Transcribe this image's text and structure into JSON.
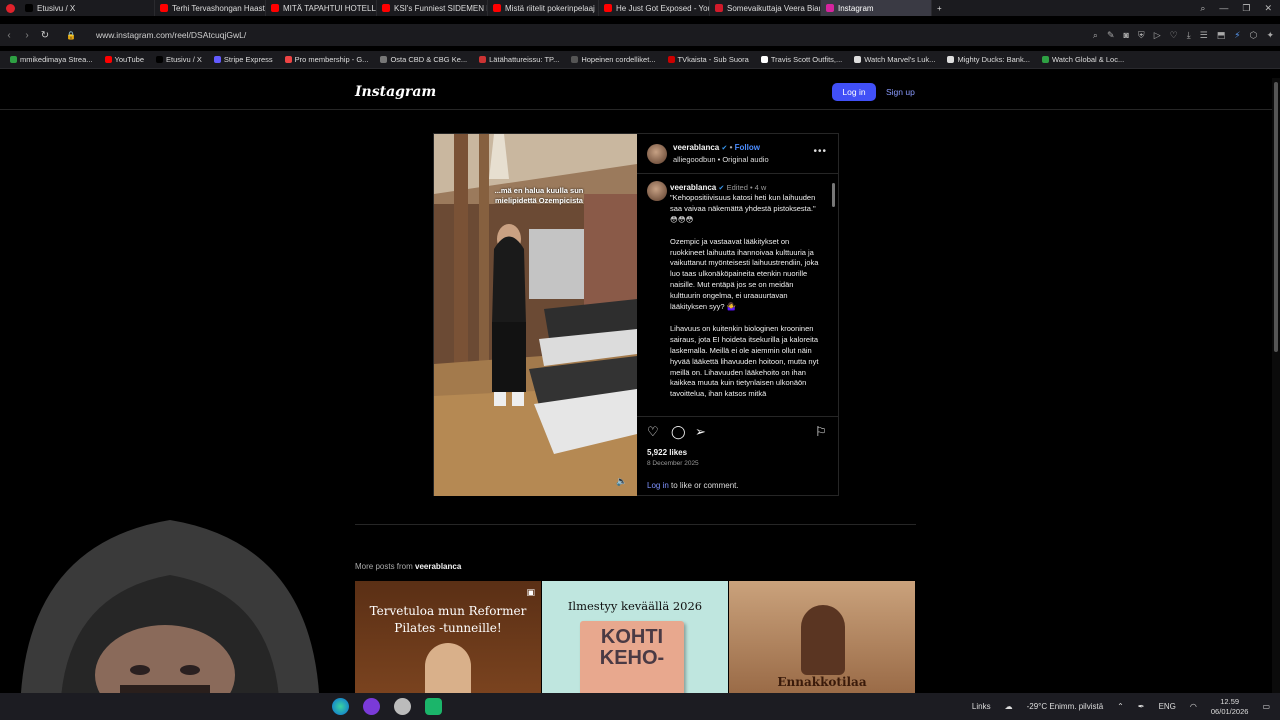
{
  "browser": {
    "tabs": [
      {
        "label": "Etusivu / X",
        "fav": "#000000"
      },
      {
        "label": "Terhi Tervashongan Haasta",
        "fav": "#ff0000"
      },
      {
        "label": "MITÄ TAPAHTUI HOTELLIS",
        "fav": "#ff0000"
      },
      {
        "label": "KSI's Funniest SIDEMEN M",
        "fav": "#ff0000"
      },
      {
        "label": "Mistä riitelit pokerinpelaaj",
        "fav": "#ff0000"
      },
      {
        "label": "He Just Got Exposed - You",
        "fav": "#ff0000"
      },
      {
        "label": "Somevaikuttaja Veera Bian",
        "fav": "#d11a2a"
      },
      {
        "label": "Instagram",
        "fav": "#d6249f"
      }
    ],
    "new_tab": "+",
    "url": "www.instagram.com/reel/DSAtcuqjGwL/",
    "bookmarks": [
      {
        "label": "mmikedimaya Strea...",
        "color": "#2ea043"
      },
      {
        "label": "YouTube",
        "color": "#ff0000"
      },
      {
        "label": "Etusivu / X",
        "color": "#000000"
      },
      {
        "label": "Stripe Express",
        "color": "#635bff"
      },
      {
        "label": "Pro membership - G...",
        "color": "#e44"
      },
      {
        "label": "Osta CBD & CBG Ke...",
        "color": "#777"
      },
      {
        "label": "Lätähattureissu: TP...",
        "color": "#c33"
      },
      {
        "label": "Hopeinen cordelliket...",
        "color": "#555"
      },
      {
        "label": "TVkaista - Sub Suora",
        "color": "#c00"
      },
      {
        "label": "Travis Scott Outfits,...",
        "color": "#fff"
      },
      {
        "label": "Watch Marvel's Luk...",
        "color": "#ddd"
      },
      {
        "label": "Mighty Ducks: Bank...",
        "color": "#ddd"
      },
      {
        "label": "Watch Global & Loc...",
        "color": "#2ea043"
      }
    ]
  },
  "instagram": {
    "logo": "Instagram",
    "login_label": "Log in",
    "signup_label": "Sign up",
    "post": {
      "video_caption": "...mä en halua kuulla sun mielipidettä Ozempicista",
      "owner": "veerablanca",
      "follow_label": "Follow",
      "audio": "alliegoodbun • Original audio",
      "comment_owner": "veerablanca",
      "comment_meta": "Edited • 4 w",
      "comment_text": "\"Kehopositiivisuus katosi heti kun laihuuden saa vaivaa näkemättä yhdestä pistoksesta.\" 😳😳😳\n\nOzempic ja vastaavat lääkitykset on ruokkineet laihuutta ihannoivaa kulttuuria ja vaikuttanut myönteisesti laihuustrendiin, joka luo taas ulkonäköpaineita etenkin nuorille naisille. Mut entäpä jos se on meidän kulttuurin ongelma, ei uraauurtavan lääkityksen syy? 🤷‍♀️\n\nLihavuus on kuitenkin biologinen krooninen sairaus, jota EI hoideta itsekurilla ja kaloreita laskemalla. Meillä ei ole aiemmin ollut näin hyvää lääkettä lihavuuden hoitoon, mutta nyt meillä on. Lihavuuden lääkehoito on ihan kaikkea muuta kuin tietynlaisen ulkonäön tavoittelua, ihan katsos mitkä",
      "likes": "5,922 likes",
      "date": "8 December 2025",
      "login_link": "Log in",
      "comment_prompt": " to like or comment."
    },
    "more_posts_prefix": "More posts from ",
    "more_posts_user": "veerablanca",
    "thumbnails": [
      {
        "text": "Tervetuloa mun Reformer Pilates -tunneille!"
      },
      {
        "text": "Ilmestyy keväällä 2026",
        "book_title": "KOHTI KEHO-"
      },
      {
        "text": "Ennakkotilaa"
      }
    ]
  },
  "taskbar": {
    "links": "Links",
    "weather": "-29°C  Enimm. pilvistä",
    "lang": "ENG",
    "time": "12.59",
    "date": "06/01/2026"
  }
}
